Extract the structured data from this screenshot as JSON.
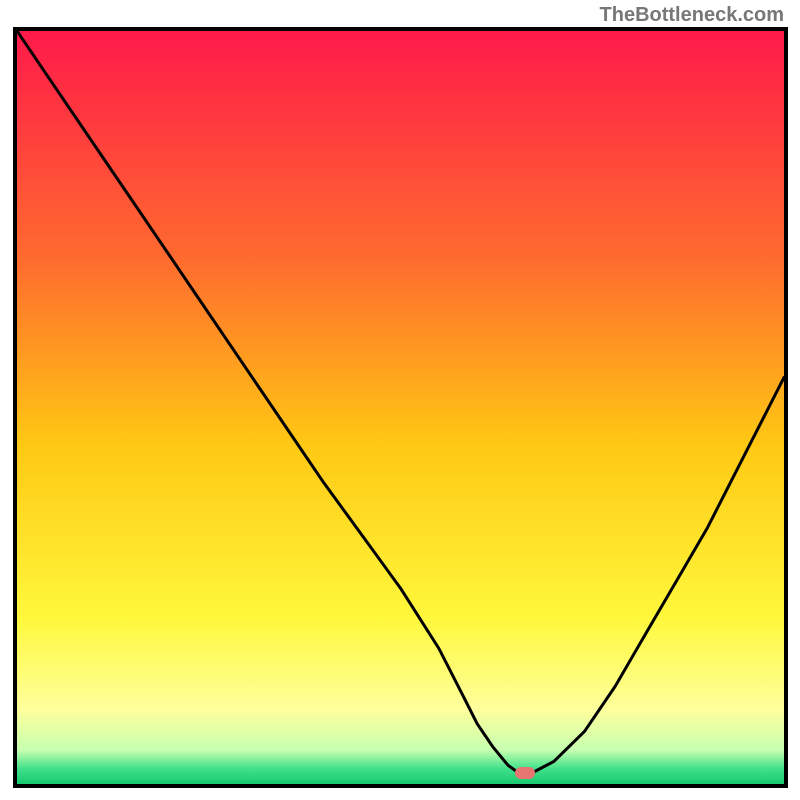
{
  "watermark": "TheBottleneck.com",
  "chart_data": {
    "type": "line",
    "title": "",
    "xlabel": "",
    "ylabel": "",
    "xlim": [
      0,
      100
    ],
    "ylim": [
      0,
      100
    ],
    "grid": false,
    "gradient_stops": [
      {
        "pos": 0.0,
        "color": "#ff1a4a"
      },
      {
        "pos": 0.3,
        "color": "#ff6a2f"
      },
      {
        "pos": 0.55,
        "color": "#ffc813"
      },
      {
        "pos": 0.78,
        "color": "#fff83c"
      },
      {
        "pos": 0.9,
        "color": "#ffff9c"
      },
      {
        "pos": 0.955,
        "color": "#c7ffb0"
      },
      {
        "pos": 0.98,
        "color": "#3fe08a"
      },
      {
        "pos": 1.0,
        "color": "#18c96f"
      }
    ],
    "series": [
      {
        "name": "bottleneck-curve",
        "x": [
          0.0,
          6,
          12,
          18,
          24,
          28,
          32,
          36,
          40,
          45,
          50,
          55,
          58,
          60,
          62,
          64,
          65.5,
          67,
          70,
          74,
          78,
          82,
          86,
          90,
          94,
          98,
          100
        ],
        "y": [
          100,
          91,
          82,
          73,
          64,
          58,
          52,
          46,
          40,
          33,
          26,
          18,
          12,
          8,
          5,
          2.5,
          1.4,
          1.4,
          3,
          7,
          13,
          20,
          27,
          34,
          42,
          50,
          54
        ]
      }
    ],
    "marker": {
      "x": 66.2,
      "y": 1.4,
      "name": "optimal-point"
    }
  }
}
